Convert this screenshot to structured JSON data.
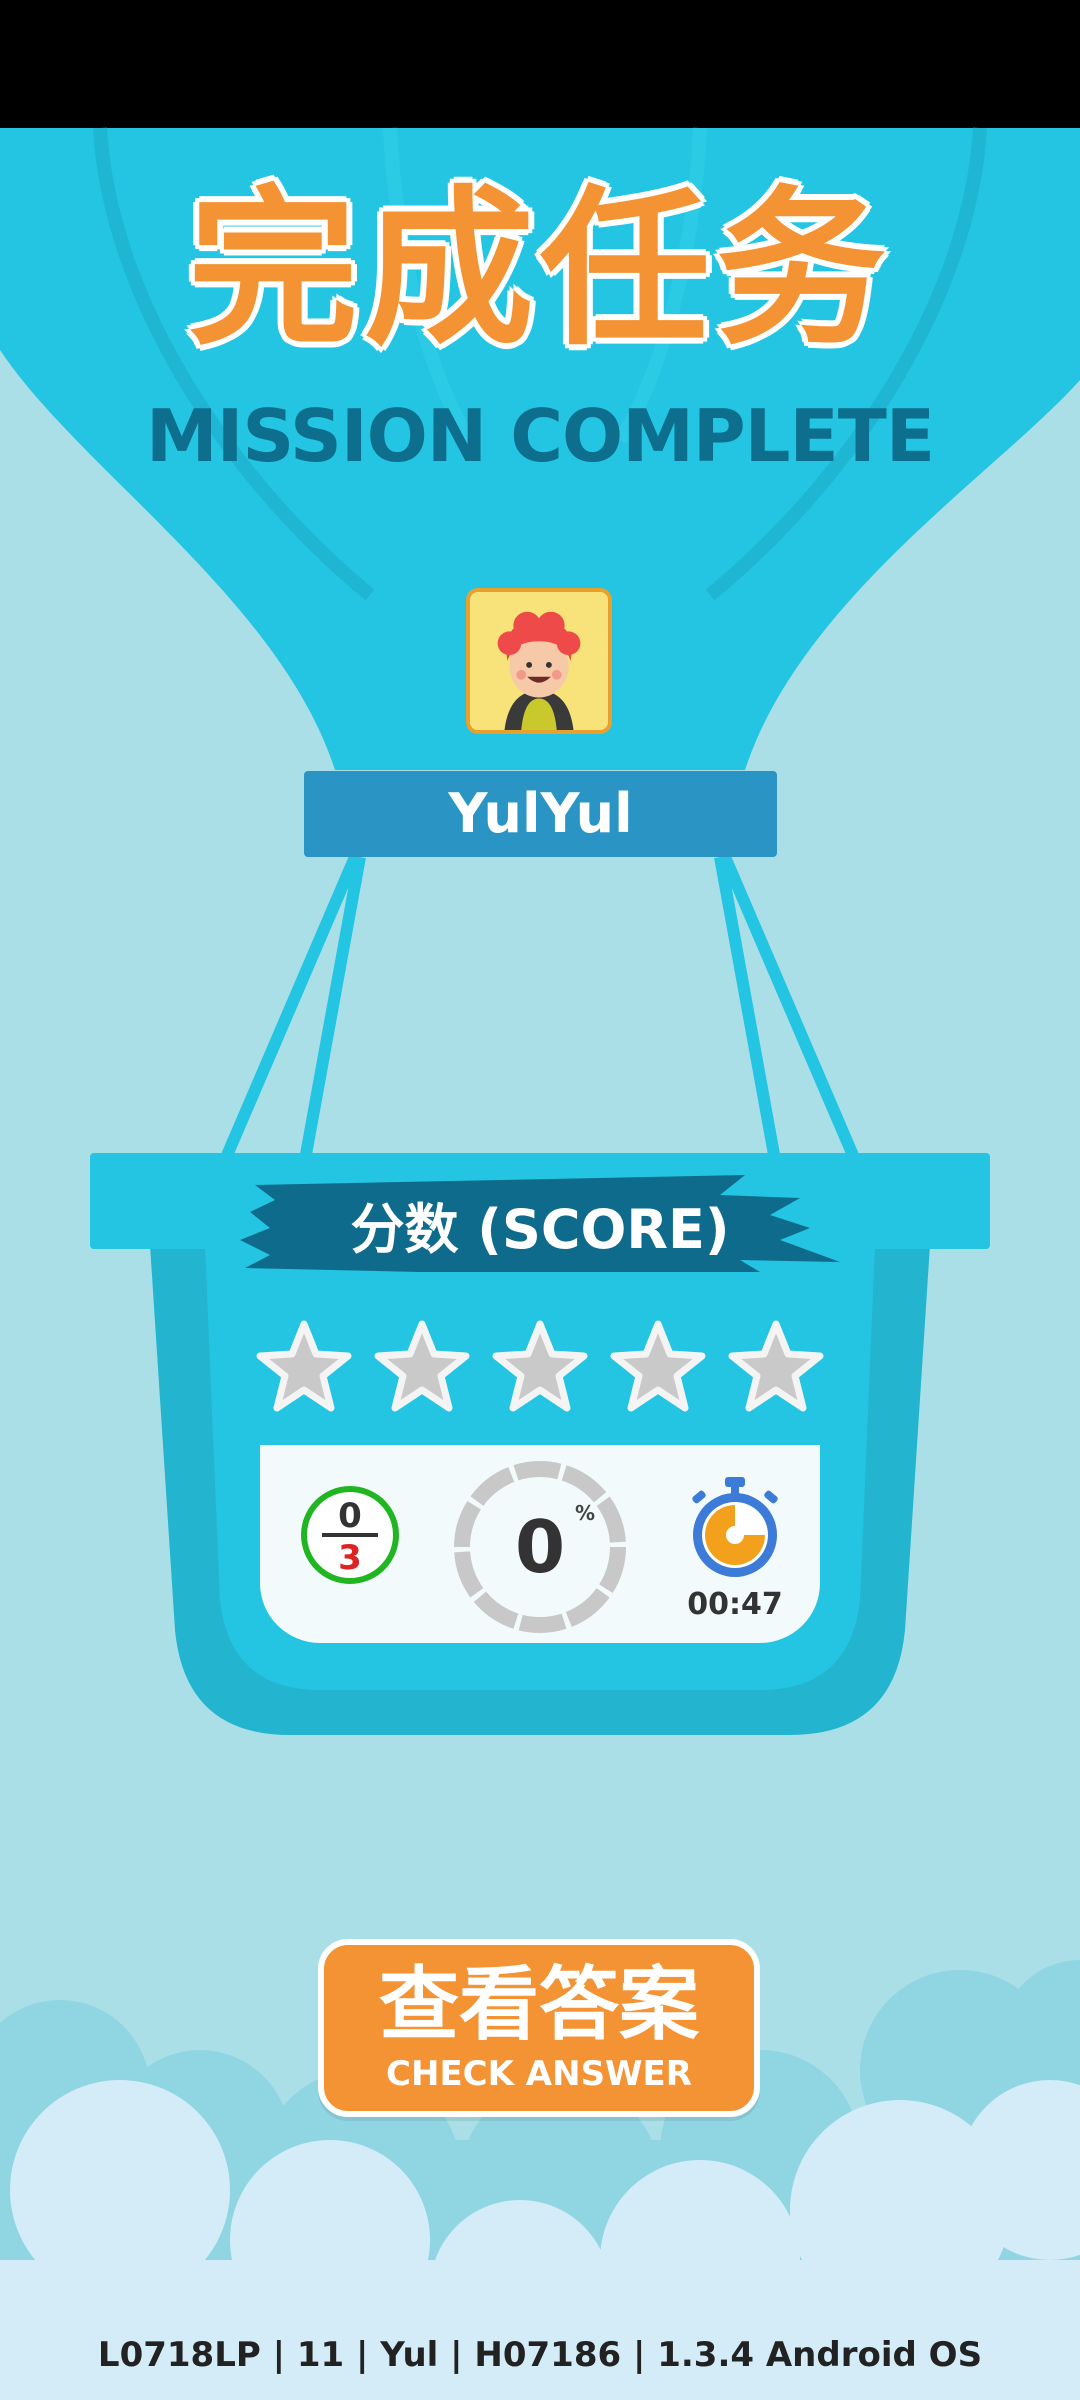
{
  "header": {
    "title_cn": "完成任务",
    "title_en": "MISSION COMPLETE"
  },
  "player": {
    "name": "YulYul",
    "avatar_icon": "child-avatar-icon"
  },
  "score": {
    "label": "分数 (SCORE)",
    "stars_total": 5,
    "stars_earned": 0,
    "correct": "0",
    "total": "3",
    "percent": "0",
    "percent_sign": "%",
    "time": "00:47"
  },
  "actions": {
    "check_answer_cn": "查看答案",
    "check_answer_en": "CHECK ANSWER"
  },
  "footer": {
    "info": "L0718LP | 11 | Yul | H07186 | 1.3.4 Android OS"
  },
  "colors": {
    "sky": "#abdfe7",
    "balloon": "#23c5e2",
    "orange": "#f39334",
    "dark_blue": "#0d6f8d"
  }
}
